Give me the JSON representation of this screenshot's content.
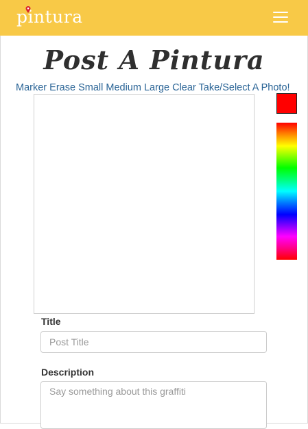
{
  "navbar": {
    "brand": "pintura",
    "accent_color": "#f8c947",
    "menu_icon": "hamburger-icon"
  },
  "page": {
    "title": "Post A Pintura"
  },
  "toolbar": {
    "marker": "Marker",
    "erase": "Erase",
    "small": "Small",
    "medium": "Medium",
    "large": "Large",
    "clear": "Clear",
    "photo": "Take/Select A Photo!",
    "link_color": "#2a6496"
  },
  "palette": {
    "selected_color": "#ff0000"
  },
  "form": {
    "title_label": "Title",
    "title_placeholder": "Post Title",
    "title_value": "",
    "description_label": "Description",
    "description_placeholder": "Say something about this graffiti",
    "description_value": ""
  }
}
